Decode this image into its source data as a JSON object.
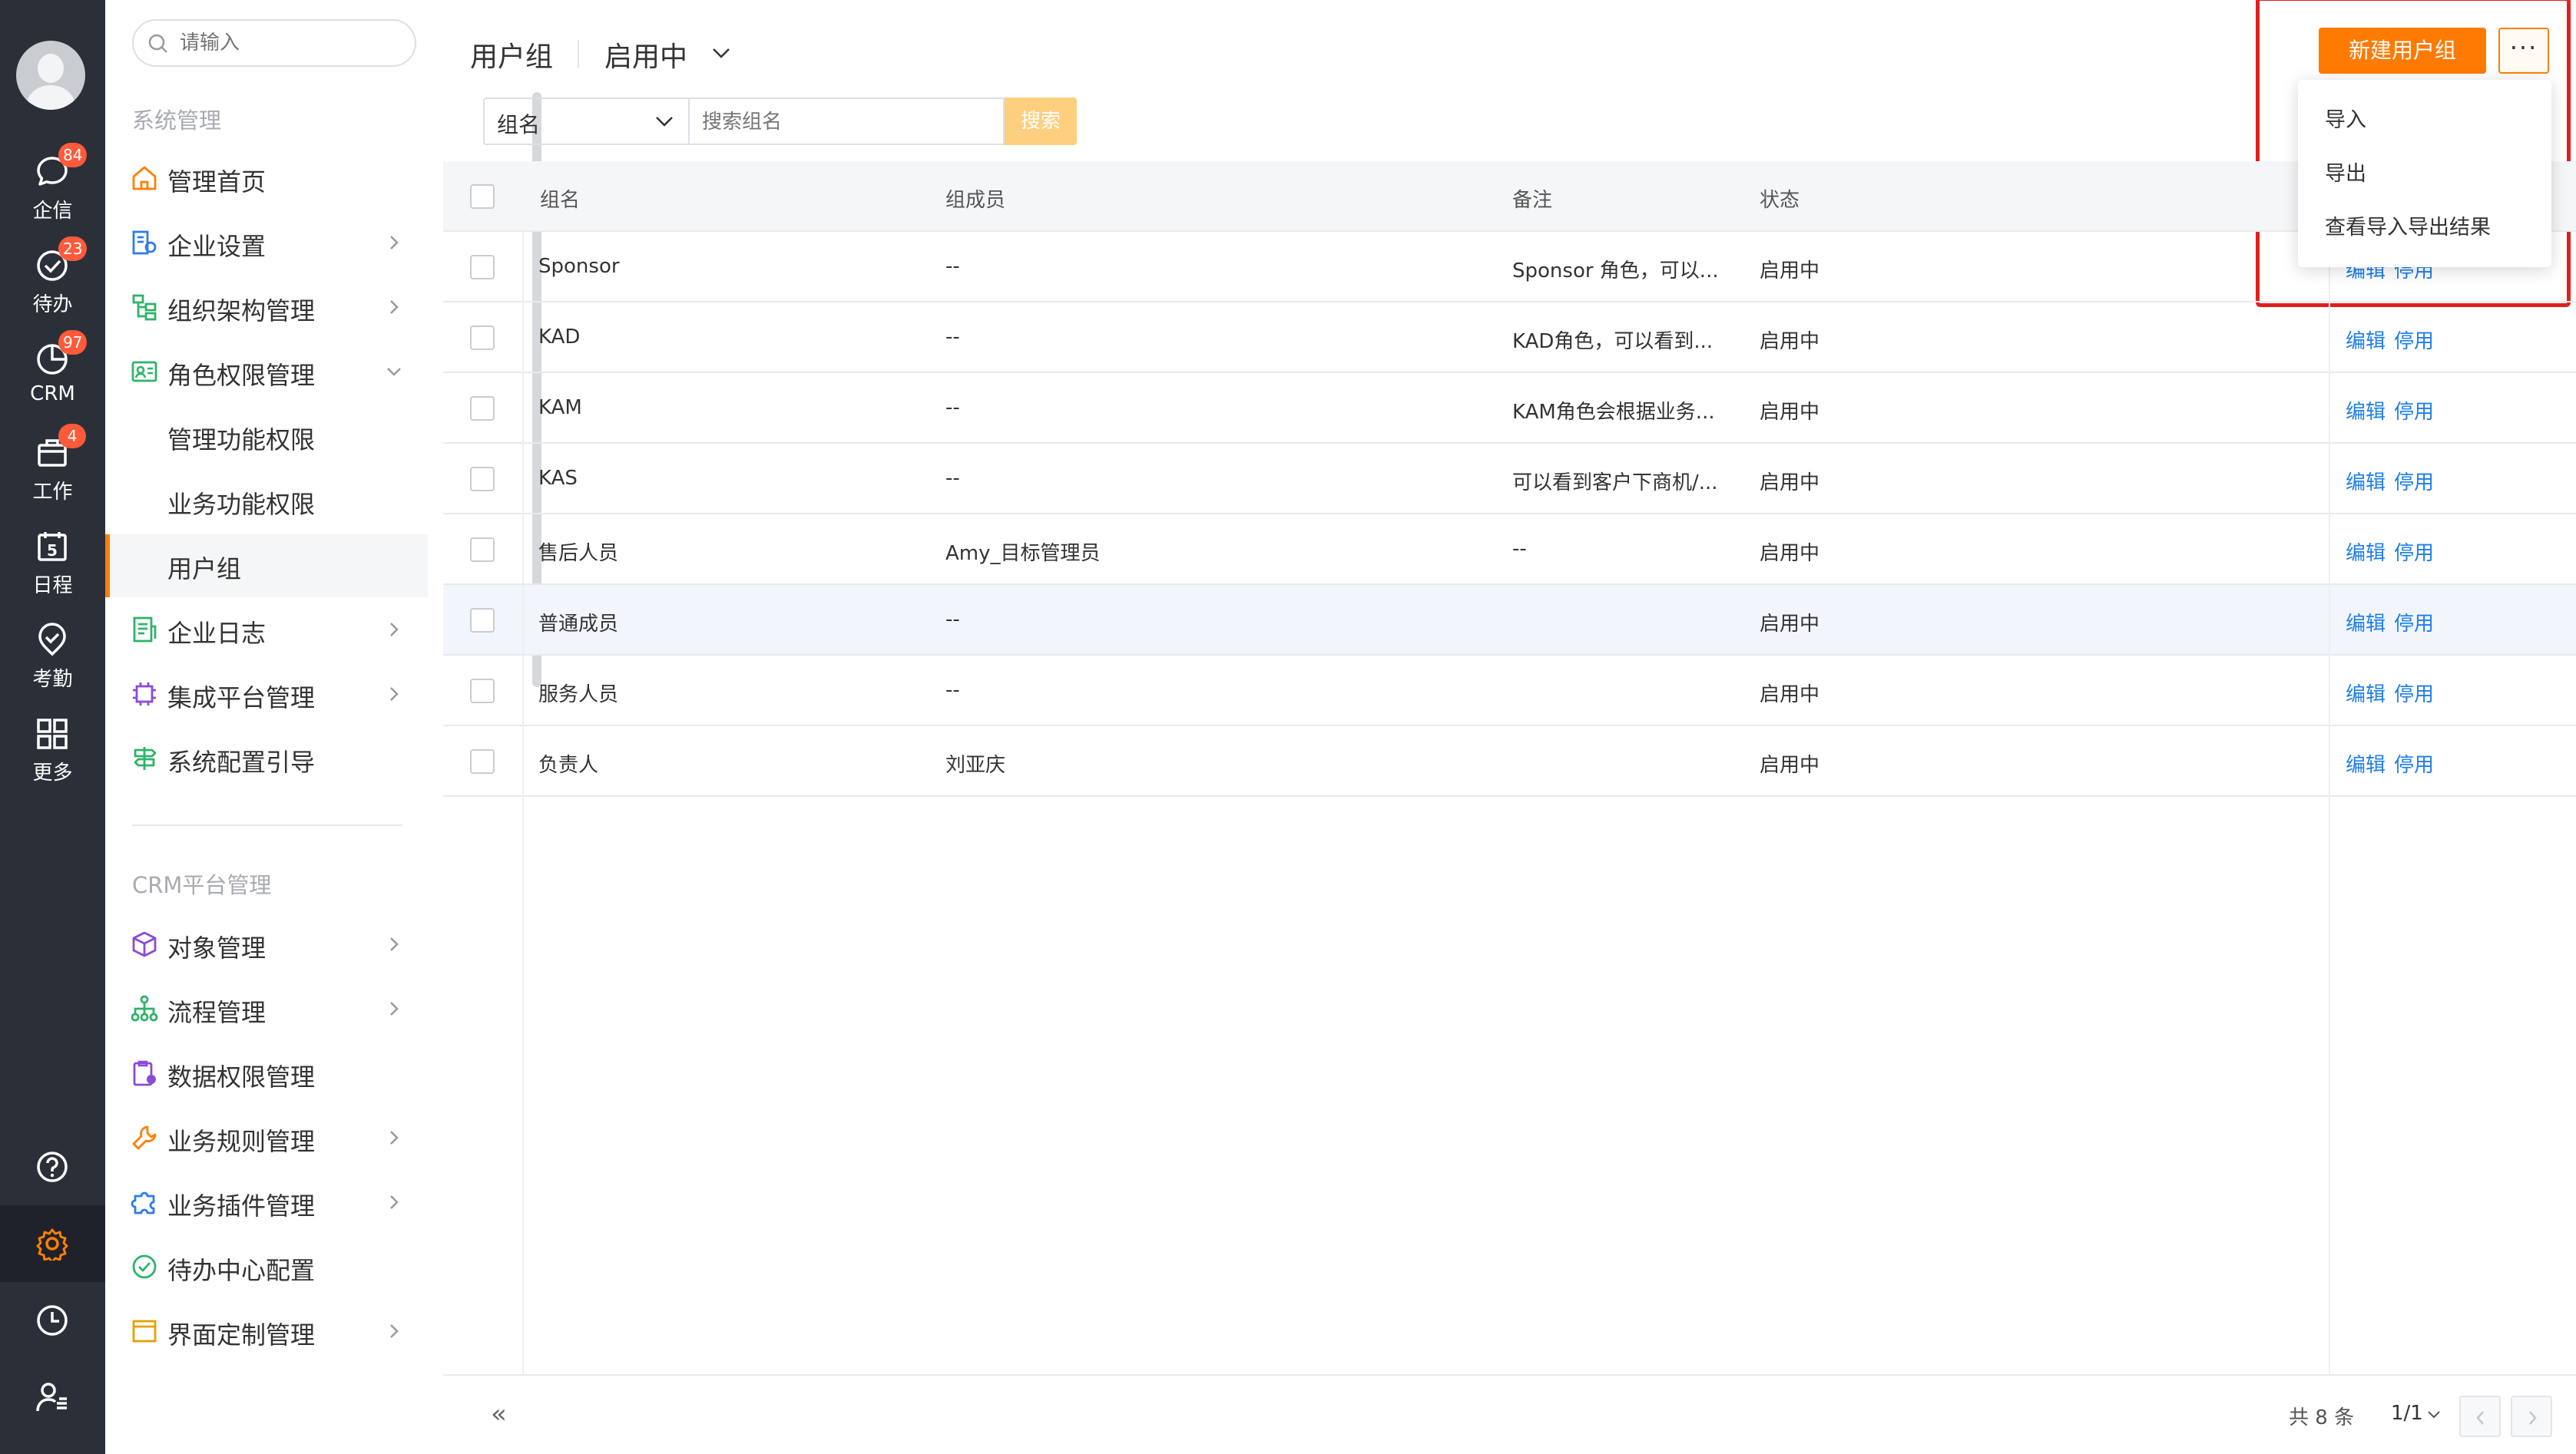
{
  "rail": {
    "items": [
      {
        "label": "企信",
        "badge": "84",
        "icon": "chat-icon"
      },
      {
        "label": "待办",
        "badge": "23",
        "icon": "todo-check-icon"
      },
      {
        "label": "CRM",
        "badge": "97",
        "icon": "crm-chart-icon"
      },
      {
        "label": "工作",
        "badge": "4",
        "icon": "briefcase-icon"
      },
      {
        "label": "日程",
        "badge": "",
        "calendar_day": "5",
        "icon": "calendar-icon"
      },
      {
        "label": "考勤",
        "badge": "",
        "icon": "attendance-icon"
      },
      {
        "label": "更多",
        "badge": "",
        "icon": "grid-apps-icon"
      }
    ],
    "bottom": [
      "help-icon",
      "settings-icon",
      "history-icon",
      "user-list-icon"
    ],
    "accent": "#ff8000"
  },
  "sidebar": {
    "search_placeholder": "请输入",
    "section1": "系统管理",
    "section2": "CRM平台管理",
    "items": [
      {
        "label": "管理首页"
      },
      {
        "label": "企业设置"
      },
      {
        "label": "组织架构管理"
      },
      {
        "label": "角色权限管理"
      },
      {
        "label": "管理功能权限"
      },
      {
        "label": "业务功能权限"
      },
      {
        "label": "用户组"
      },
      {
        "label": "企业日志"
      },
      {
        "label": "集成平台管理"
      },
      {
        "label": "系统配置引导"
      }
    ],
    "crm_items": [
      {
        "label": "对象管理"
      },
      {
        "label": "流程管理"
      },
      {
        "label": "数据权限管理"
      },
      {
        "label": "业务规则管理"
      },
      {
        "label": "业务插件管理"
      },
      {
        "label": "待办中心配置"
      },
      {
        "label": "界面定制管理"
      }
    ],
    "collapse_glyph": "«"
  },
  "header": {
    "title": "用户组",
    "status_filter": "启用中",
    "new_button": "新建用户组",
    "more_button": "···"
  },
  "more_menu": {
    "items": [
      "导入",
      "导出",
      "查看导入导出结果"
    ]
  },
  "filter": {
    "field": "组名",
    "keyword_placeholder": "搜索组名",
    "search_button": "搜索"
  },
  "table": {
    "columns": [
      "组名",
      "组成员",
      "备注",
      "状态"
    ],
    "rows": [
      {
        "name": "Sponsor",
        "members": "--",
        "note": "Sponsor 角色，可以...",
        "status": "启用中"
      },
      {
        "name": "KAD",
        "members": "--",
        "note": "KAD角色，可以看到...",
        "status": "启用中"
      },
      {
        "name": "KAM",
        "members": "--",
        "note": "KAM角色会根据业务...",
        "status": "启用中"
      },
      {
        "name": "KAS",
        "members": "--",
        "note": "可以看到客户下商机/...",
        "status": "启用中"
      },
      {
        "name": "售后人员",
        "members": "Amy_目标管理员",
        "note": "--",
        "status": "启用中"
      },
      {
        "name": "普通成员",
        "members": "--",
        "note": "",
        "status": "启用中"
      },
      {
        "name": "服务人员",
        "members": "--",
        "note": "",
        "status": "启用中"
      },
      {
        "name": "负责人",
        "members": "刘亚庆",
        "note": "",
        "status": "启用中"
      }
    ],
    "action_edit": "编辑",
    "action_disable": "停用"
  },
  "pager": {
    "total": "共 8 条",
    "page": "1/1"
  },
  "colors": {
    "primary": "#ff7a00",
    "link": "#1e7ee8",
    "rail_bg": "#2b2f38",
    "highlight_box": "#e0201c"
  }
}
